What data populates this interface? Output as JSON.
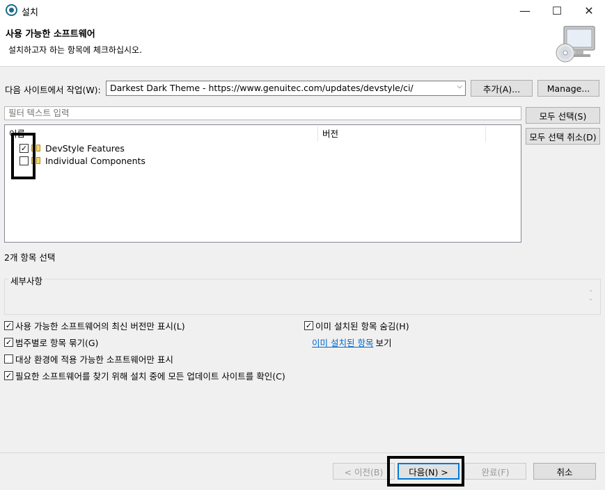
{
  "window": {
    "title": "설치",
    "minimize_glyph": "—",
    "maximize_glyph": "☐",
    "close_glyph": "✕"
  },
  "header": {
    "title": "사용 가능한 소프트웨어",
    "description": "설치하고자 하는 항목에 체크하십시오."
  },
  "site": {
    "label": "다음 사이트에서 작업(W):",
    "value": "Darkest Dark Theme - https://www.genuitec.com/updates/devstyle/ci/",
    "add_button": "추가(A)...",
    "manage_button": "Manage..."
  },
  "filter": {
    "placeholder": "필터 텍스트 입력"
  },
  "buttons": {
    "select_all": "모두 선택(S)",
    "deselect_all": "모두 선택 취소(D)"
  },
  "tree": {
    "columns": [
      "이름",
      "버전"
    ],
    "items": [
      {
        "label": "DevStyle Features",
        "checked": true
      },
      {
        "label": "Individual Components",
        "checked": false
      }
    ]
  },
  "selection_count": "2개 항목 선택",
  "details": {
    "label": "세부사항"
  },
  "options": {
    "latest_only": {
      "label": "사용 가능한 소프트웨어의 최신 버전만 표시(L)",
      "checked": true
    },
    "group_by_category": {
      "label": "범주별로 항목 묶기(G)",
      "checked": true
    },
    "applicable_only": {
      "label": "대상 환경에 적용 가능한 소프트웨어만 표시",
      "checked": false
    },
    "contact_all_sites": {
      "label": "필요한 소프트웨어를 찾기 위해 설치 중에 모든 업데이트 사이트를 확인(C)",
      "checked": true
    },
    "hide_installed": {
      "label": "이미 설치된 항목 숨김(H)",
      "checked": true
    },
    "installed_link": "이미 설치된 항목",
    "installed_suffix": "보기"
  },
  "footer": {
    "back": "< 이전(B)",
    "next": "다음(N) >",
    "finish": "완료(F)",
    "cancel": "취소"
  },
  "check_glyph": "✓"
}
